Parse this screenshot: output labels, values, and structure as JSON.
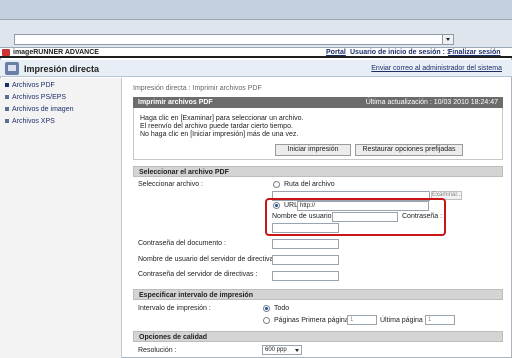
{
  "header": {
    "brand": "imageRUNNER ADVANCE",
    "portal_link": "Portal",
    "user_text": "Usuario de inicio de sesión : 1",
    "logout_link": "Finalizar sesión"
  },
  "titlebar": {
    "title": "Impresión directa",
    "send_email_link": "Enviar correo al administrador del sistema"
  },
  "sidebar": {
    "items": [
      {
        "label": "Archivos PDF",
        "active": true
      },
      {
        "label": "Archivos PS/EPS",
        "active": false
      },
      {
        "label": "Archivos de imagen",
        "active": false
      },
      {
        "label": "Archivos XPS",
        "active": false
      }
    ]
  },
  "breadcrumb": "Impresión directa : Imprimir archivos PDF",
  "main": {
    "panel_title": "Imprimir archivos PDF",
    "last_update": "Última actualización : 10/03 2010 18:24:47",
    "info": [
      "Haga clic en [Examinar] para seleccionar un archivo.",
      "El reenvío del archivo puede tardar cierto tiempo.",
      "No haga clic en [Iniciar impresión] más de una vez."
    ],
    "start_button": "Iniciar impresión",
    "restore_button": "Restaurar opciones prefijadas",
    "select_section": "Seleccionar el archivo PDF",
    "select_file_label": "Seleccionar archivo :",
    "file_path_option": "Ruta del archivo",
    "browse_button": "Examinar...",
    "url_option": "URL",
    "url_value": "http://",
    "username_label": "Nombre de usuario :",
    "password_label": "Contraseña :",
    "doc_password_label": "Contraseña del documento :",
    "policy_user_label": "Nombre de usuario del servidor de directivas :",
    "policy_password_label": "Contraseña del servidor de directivas :",
    "range_section": "Especificar intervalo de impresión",
    "range_label": "Intervalo de impresión :",
    "all_option": "Todo",
    "pages_option": "Páginas Primera página :",
    "first_page_value": "1",
    "last_page_label": "Última página :",
    "last_page_value": "1",
    "quality_section": "Opciones de calidad",
    "resolution_label": "Resolución :",
    "resolution_value": "600 ppp"
  }
}
